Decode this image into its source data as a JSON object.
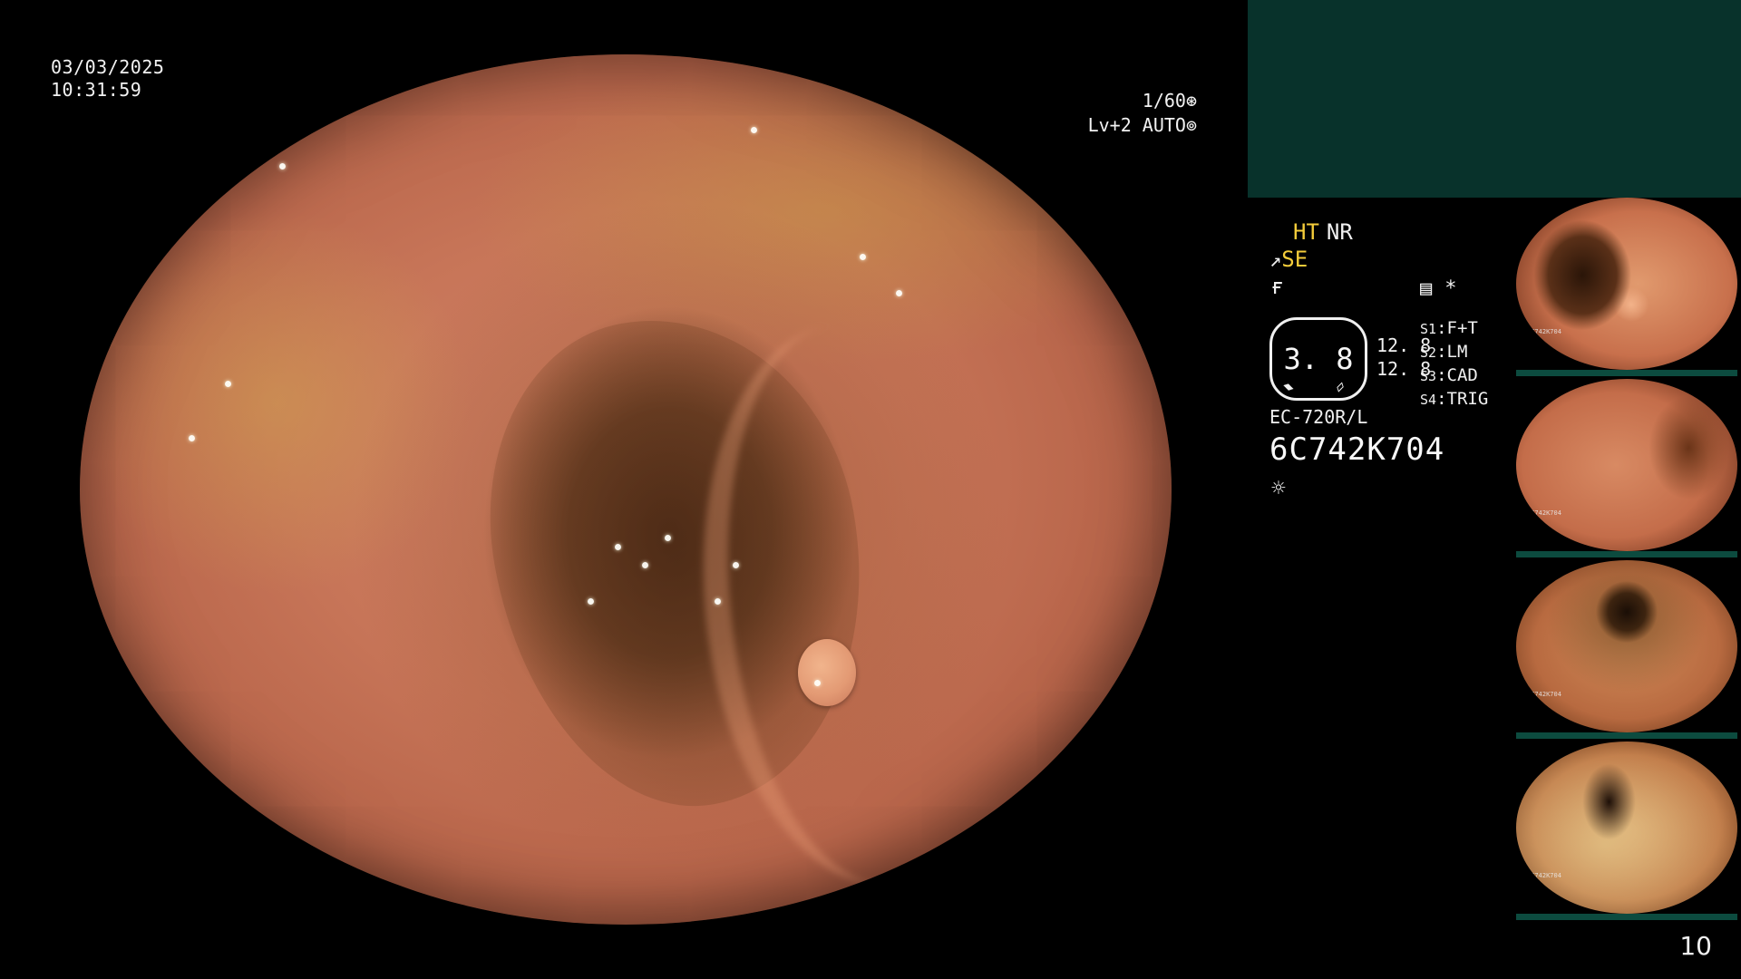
{
  "overlay": {
    "date": "03/03/2025",
    "time": "10:31:59",
    "shutter_speed": "1/60",
    "shutter_icon": "aperture-icon",
    "light_level": "Lv+2 AUTO",
    "light_icon": "auto-iris-icon"
  },
  "status": {
    "ht_label": "HT",
    "nr_label": "NR",
    "se_glyph": "↗",
    "se_label": "SE",
    "f_glyph": "ғ",
    "memory_icon": "memory-card-icon",
    "memory_glyph": "▤",
    "star_glyph": "*",
    "gauge_value": "3. 8",
    "gauge_left_mark": "▰",
    "gauge_right_mark": "▱",
    "scale_top": "12. 8",
    "scale_bottom": "12. 8",
    "switches": [
      {
        "key": "S1",
        "value": "F+T"
      },
      {
        "key": "S2",
        "value": "LM"
      },
      {
        "key": "S3",
        "value": "CAD"
      },
      {
        "key": "S4",
        "value": "TRIG"
      }
    ],
    "model": "EC-720R/L",
    "serial": "6C742K704",
    "brightness_glyph": "☼"
  },
  "thumbnails": [
    {
      "label": "6C742K704"
    },
    {
      "label": "6C742K704"
    },
    {
      "label": "6C742K704"
    },
    {
      "label": "6C742K704"
    }
  ],
  "colors": {
    "highlight": "#f4cc3a",
    "panel": "#08322b",
    "thumb_bar": "#0c4b3f"
  },
  "page_number": "10"
}
